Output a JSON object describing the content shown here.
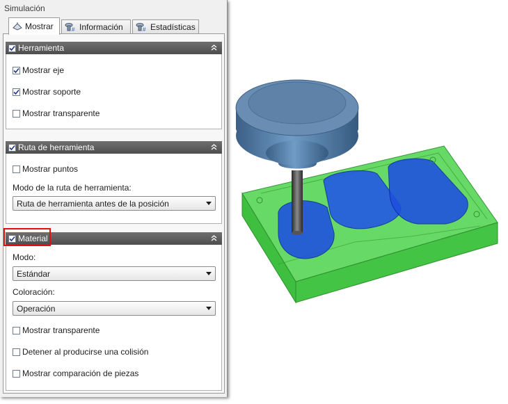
{
  "panel": {
    "title": "Simulación",
    "tabs": [
      {
        "label": "Mostrar",
        "icon": "display-icon",
        "active": true
      },
      {
        "label": "Información",
        "icon": "info-tool-icon",
        "active": false
      },
      {
        "label": "Estadísticas",
        "icon": "stats-tool-icon",
        "active": false
      }
    ]
  },
  "herramienta": {
    "title": "Herramienta",
    "checked": true,
    "items": [
      {
        "label": "Mostrar eje",
        "checked": true
      },
      {
        "label": "Mostrar soporte",
        "checked": true
      },
      {
        "label": "Mostrar transparente",
        "checked": false
      }
    ]
  },
  "ruta": {
    "title": "Ruta de herramienta",
    "checked": true,
    "mostrar_puntos": {
      "label": "Mostrar puntos",
      "checked": false
    },
    "modo_label": "Modo de la ruta de herramienta:",
    "modo_value": "Ruta de herramienta antes de la posición"
  },
  "material": {
    "title": "Material",
    "checked": true,
    "modo_label": "Modo:",
    "modo_value": "Estándar",
    "coloracion_label": "Coloración:",
    "coloracion_value": "Operación",
    "items": [
      {
        "label": "Mostrar transparente",
        "checked": false
      },
      {
        "label": "Detener al producirse una colisión",
        "checked": false
      },
      {
        "label": "Mostrar comparación de piezas",
        "checked": false
      }
    ]
  },
  "colors": {
    "header": "#5e5e5e",
    "stock_green": "#4cc94c",
    "pocket_blue": "#1e4fe0",
    "tool_blue": "#5a84ad",
    "highlight": "#e01010"
  }
}
